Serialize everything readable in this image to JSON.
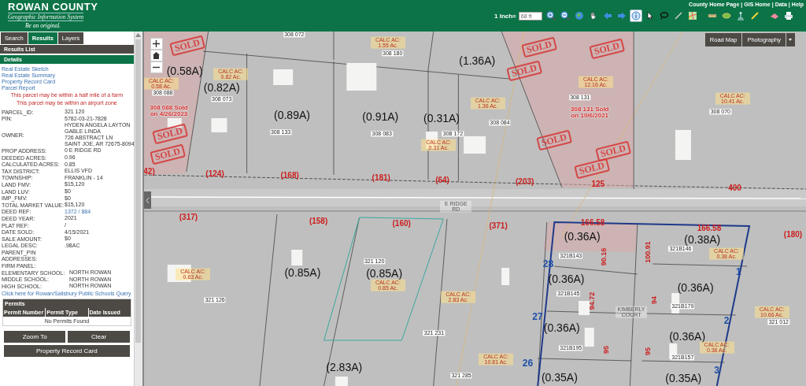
{
  "header": {
    "logo_title": "ROWAN COUNTY",
    "logo_subtitle": "Geographic Information System",
    "logo_tagline": "Be an original.",
    "scale_label": "1 Inch=",
    "scale_value": "68 ft",
    "tool_groups": [
      [
        {
          "kind": "zoom_in",
          "selected": false
        },
        {
          "kind": "zoom_out",
          "selected": false
        },
        {
          "kind": "globe",
          "selected": false
        },
        {
          "kind": "hand",
          "selected": false
        },
        {
          "kind": "back",
          "selected": false
        },
        {
          "kind": "forward",
          "selected": false
        },
        {
          "kind": "info",
          "selected": true
        },
        {
          "kind": "pointer",
          "selected": false
        },
        {
          "kind": "lasso",
          "selected": false
        },
        {
          "kind": "line",
          "selected": false
        },
        {
          "kind": "map",
          "selected": false
        }
      ],
      [
        {
          "kind": "measure",
          "selected": false
        },
        {
          "kind": "area",
          "selected": false
        },
        {
          "kind": "tower",
          "selected": false
        },
        {
          "kind": "pencil",
          "selected": false
        }
      ],
      [
        {
          "kind": "eraser",
          "selected": false
        },
        {
          "kind": "printer",
          "selected": false
        }
      ]
    ],
    "links": [
      "County Home Page",
      "GIS Home",
      "Data",
      "Help"
    ],
    "link_separator": "|"
  },
  "sidebar": {
    "tabs": [
      {
        "label": "Search",
        "selected": false
      },
      {
        "label": "Results",
        "selected": true
      },
      {
        "label": "Layers",
        "selected": false
      }
    ],
    "results_list": "Results List",
    "details": "Details",
    "links": [
      "Real Estate Sketch",
      "Real Estate Summary",
      "Property Record Card",
      "Parcel Report"
    ],
    "notices": [
      "This parcel may be within a half mile of a farm",
      "This parcel may be within an airport zone"
    ],
    "attributes": [
      {
        "kind": "plain",
        "label": "PARCEL_ID:",
        "lines": [
          "321 120"
        ]
      },
      {
        "kind": "plain",
        "label": "PIN:",
        "lines": [
          "5782-03-21-7828"
        ]
      },
      {
        "kind": "plain",
        "label": "OWNER:",
        "lines": [
          "HYDEN ANGELA LAYTON",
          "GABLE LINDA",
          "726 ABSTRACT LN",
          "SAINT JOE, AR 72675-8094"
        ]
      },
      {
        "kind": "plain",
        "label": "PROP ADDRESS:",
        "lines": [
          "0 E RIDGE RD"
        ]
      },
      {
        "kind": "plain",
        "label": "DEEDED ACRES:",
        "lines": [
          "0.96"
        ]
      },
      {
        "kind": "plain",
        "label": "CALCULATED ACRES:",
        "lines": [
          "0.85"
        ]
      },
      {
        "kind": "plain",
        "label": "TAX DISTRICT:",
        "lines": [
          "ELLIS VFD"
        ]
      },
      {
        "kind": "plain",
        "label": "TOWNSHIP:",
        "lines": [
          "FRANKLIN - 14"
        ]
      },
      {
        "kind": "plain",
        "label": "LAND FMV:",
        "lines": [
          "$15,120"
        ]
      },
      {
        "kind": "plain",
        "label": "LAND LUV:",
        "lines": [
          "$0"
        ]
      },
      {
        "kind": "plain",
        "label": "IMP_FMV:",
        "lines": [
          "$0"
        ]
      },
      {
        "kind": "plain",
        "label": "TOTAL MARKET VALUE:",
        "lines": [
          "$15,120"
        ]
      },
      {
        "kind": "link",
        "label": "DEED REF:",
        "lines": [
          "1372 / 884"
        ]
      },
      {
        "kind": "plain",
        "label": "DEED YEAR:",
        "lines": [
          "2021"
        ]
      },
      {
        "kind": "plain",
        "label": "PLAT REF:",
        "lines": [
          "/"
        ]
      },
      {
        "kind": "plain",
        "label": "DATE SOLD:",
        "lines": [
          "4/15/2021"
        ]
      },
      {
        "kind": "plain",
        "label": "SALE AMOUNT:",
        "lines": [
          "$0"
        ]
      },
      {
        "kind": "plain",
        "label": "LEGAL DESC:",
        "lines": [
          ".98AC"
        ]
      },
      {
        "kind": "plain",
        "label": "PARENT_PIN"
      },
      {
        "kind": "plain",
        "label": "ADDRESSES:"
      },
      {
        "kind": "plain",
        "label": "FIRM PANEL:"
      },
      {
        "kind": "school",
        "label": "ELEMENTARY SCHOOL:",
        "lines": [
          "NORTH ROWAN"
        ]
      },
      {
        "kind": "school",
        "label": "MIDDLE SCHOOL:",
        "lines": [
          "NORTH ROWAN"
        ]
      },
      {
        "kind": "school",
        "label": "HIGH SCHOOL:",
        "lines": [
          "NORTH ROWAN"
        ]
      }
    ],
    "schools_link": "Click here for Rowan/Salisbury Public Schools Query",
    "permits": {
      "title": "Permits",
      "columns": [
        "Permit Number",
        "Permit Type",
        "Date Issued"
      ],
      "empty": "No Permits Found"
    },
    "buttons": [
      "Zoom To",
      "Clear",
      "Property Record Card"
    ]
  },
  "map": {
    "basemaps": [
      {
        "label": "Road Map",
        "selected": false
      },
      {
        "label": "Photography",
        "selected": false
      }
    ],
    "sold_stamps": [
      "SOLD",
      "SOLD",
      "SOLD",
      "SOLD",
      "SOLD",
      "SOLD",
      "SOLD",
      "SOLD",
      "SOLD"
    ],
    "labels": [
      {
        "kind": "parcel_id",
        "text": "308 072"
      },
      {
        "kind": "calc",
        "text": "CALC AC: 1.55 Ac."
      },
      {
        "kind": "parcel_id",
        "text": "308 180"
      },
      {
        "kind": "acreage",
        "text": "(1.36A)"
      },
      {
        "kind": "acreage",
        "text": "(0.58A)"
      },
      {
        "kind": "calc",
        "text": "CALC AC: 0.58 Ac."
      },
      {
        "kind": "calc",
        "text": "CALC AC: 0.82 Ac."
      },
      {
        "kind": "calc",
        "text": "CALC AC: 12.16 Ac."
      },
      {
        "kind": "calc",
        "text": "CALC AC: 10.41 Ac."
      },
      {
        "kind": "parcel_id",
        "text": "308 088"
      },
      {
        "kind": "acreage",
        "text": "(0.82A)"
      },
      {
        "kind": "parcel_id",
        "text": "308 073"
      },
      {
        "kind": "sold",
        "text": "308 088 Sold on 4/26/2023"
      },
      {
        "kind": "parcel_id",
        "text": "308 131"
      },
      {
        "kind": "calc",
        "text": "CALC AC: 1.36 Ac."
      },
      {
        "kind": "sold",
        "text": "308 131 Sold on 10/6/2021"
      },
      {
        "kind": "acreage",
        "text": "(0.89A)"
      },
      {
        "kind": "acreage",
        "text": "(0.91A)"
      },
      {
        "kind": "acreage",
        "text": "(0.31A)"
      },
      {
        "kind": "parcel_id",
        "text": "308 070"
      },
      {
        "kind": "parcel_id",
        "text": "308 084"
      },
      {
        "kind": "parcel_id",
        "text": "308 133"
      },
      {
        "kind": "parcel_id",
        "text": "308 083"
      },
      {
        "kind": "parcel_id",
        "text": "308 172"
      },
      {
        "kind": "calc",
        "text": "CALC AC: 0.31 Ac."
      },
      {
        "kind": "frontage",
        "text": "42)"
      },
      {
        "kind": "frontage",
        "text": "(124)"
      },
      {
        "kind": "frontage",
        "text": "(168)"
      },
      {
        "kind": "frontage",
        "text": "(181)"
      },
      {
        "kind": "frontage",
        "text": "(64)"
      },
      {
        "kind": "frontage",
        "text": "(203)"
      },
      {
        "kind": "frontage",
        "text": "125"
      },
      {
        "kind": "frontage",
        "text": "400"
      },
      {
        "kind": "street",
        "text": "E RIDGE RD"
      },
      {
        "kind": "frontage",
        "text": "(317)"
      },
      {
        "kind": "frontage",
        "text": "(158)"
      },
      {
        "kind": "frontage",
        "text": "(160)"
      },
      {
        "kind": "frontage",
        "text": "(371)"
      },
      {
        "kind": "frontage",
        "text": "166.58"
      },
      {
        "kind": "frontage",
        "text": "166.58"
      },
      {
        "kind": "frontage",
        "text": "(180)"
      },
      {
        "kind": "acreage",
        "text": "(0.36A)"
      },
      {
        "kind": "acreage",
        "text": "(0.38A)"
      },
      {
        "kind": "parcel_id",
        "text": "321B143"
      },
      {
        "kind": "parcel_id",
        "text": "321B146"
      },
      {
        "kind": "calc",
        "text": "CALC AC: 0.38 Ac."
      },
      {
        "kind": "lot",
        "text": "28"
      },
      {
        "kind": "side",
        "text": "90.16"
      },
      {
        "kind": "side",
        "text": "100.91"
      },
      {
        "kind": "lot",
        "text": "1"
      },
      {
        "kind": "parcel_id",
        "text": "321 120"
      },
      {
        "kind": "calc",
        "text": "CALC AC: 0.63 Ac."
      },
      {
        "kind": "acreage",
        "text": "(0.85A)"
      },
      {
        "kind": "acreage",
        "text": "(0.85A)"
      },
      {
        "kind": "calc",
        "text": "CALC AC: 0.85 Ac."
      },
      {
        "kind": "acreage",
        "text": "(0.36A)"
      },
      {
        "kind": "acreage",
        "text": "(0.36A)"
      },
      {
        "kind": "calc",
        "text": "CALC AC: 2.83 Ac."
      },
      {
        "kind": "parcel_id",
        "text": "321B145"
      },
      {
        "kind": "parcel_id",
        "text": "321 126"
      },
      {
        "kind": "side",
        "text": "94.72"
      },
      {
        "kind": "side",
        "text": "94"
      },
      {
        "kind": "lot",
        "text": "27"
      },
      {
        "kind": "parcel_id",
        "text": "321B179"
      },
      {
        "kind": "street",
        "text": "KIMBERLY COURT"
      },
      {
        "kind": "lot",
        "text": "2"
      },
      {
        "kind": "calc",
        "text": "CALC AC: 10.66 Ac."
      },
      {
        "kind": "parcel_id",
        "text": "321 012"
      },
      {
        "kind": "parcel_id",
        "text": "321 231"
      },
      {
        "kind": "acreage",
        "text": "(0.36A)"
      },
      {
        "kind": "acreage",
        "text": "(0.36A)"
      },
      {
        "kind": "calc",
        "text": "CALC AC: 10.81 Ac."
      },
      {
        "kind": "parcel_id",
        "text": "321B195"
      },
      {
        "kind": "side",
        "text": "95"
      },
      {
        "kind": "side",
        "text": "95"
      },
      {
        "kind": "parcel_id",
        "text": "321B157"
      },
      {
        "kind": "calc",
        "text": "CALC AC: 0.36 Ac."
      },
      {
        "kind": "acreage",
        "text": "(2.83A)"
      },
      {
        "kind": "parcel_id",
        "text": "321 285"
      },
      {
        "kind": "lot",
        "text": "26"
      },
      {
        "kind": "acreage",
        "text": "(0.35A)"
      },
      {
        "kind": "acreage",
        "text": "(0.35A)"
      },
      {
        "kind": "lot",
        "text": "3"
      }
    ]
  }
}
